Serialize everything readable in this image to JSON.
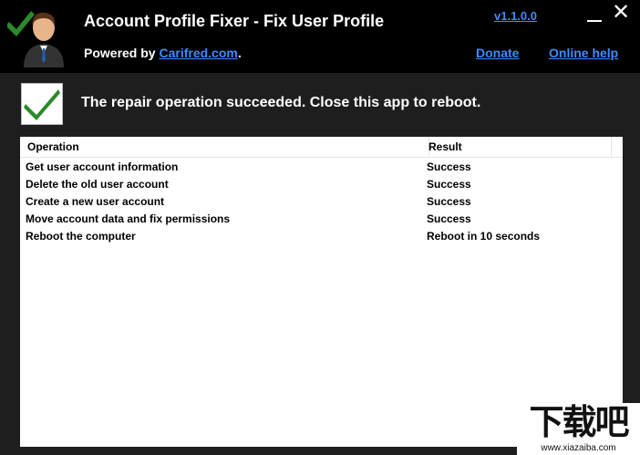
{
  "header": {
    "title": "Account Profile Fixer - Fix User Profile",
    "powered_prefix": "Powered by ",
    "powered_link": "Carifred.com",
    "powered_suffix": ".",
    "version": "v1.1.0.0",
    "donate": "Donate",
    "online_help": "Online help",
    "close_symbol": "✕"
  },
  "status": {
    "message": "The repair operation succeeded. Close this app to reboot.",
    "icon": "checkmark-icon"
  },
  "table": {
    "columns": [
      "Operation",
      "Result"
    ],
    "rows": [
      [
        "Get user account information",
        "Success"
      ],
      [
        "Delete the old user account",
        "Success"
      ],
      [
        "Create a new user account",
        "Success"
      ],
      [
        "Move account data and fix permissions",
        "Success"
      ],
      [
        "Reboot the computer",
        "Reboot in 10 seconds"
      ]
    ]
  },
  "watermark": {
    "big": "下载吧",
    "small": "www.xiazaiba.com"
  },
  "colors": {
    "accent_link": "#3f8bff",
    "check_green": "#2b8a2b",
    "header_bg": "#000000",
    "body_bg": "#1e1e1e"
  }
}
